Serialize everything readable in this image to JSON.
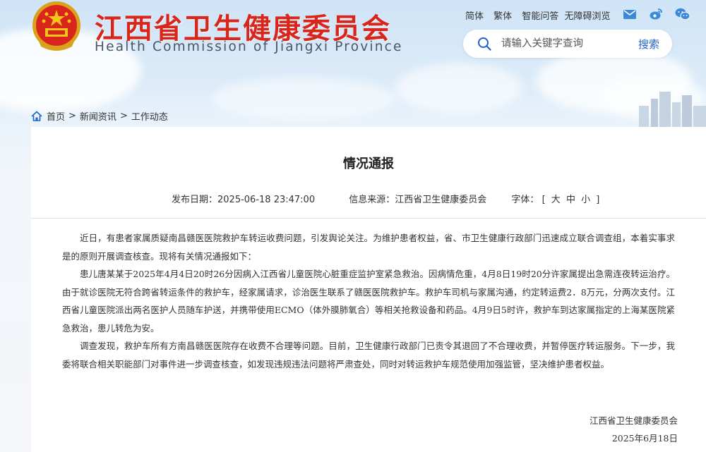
{
  "header": {
    "site_title": "江西省卫生健康委员会",
    "site_subtitle": "Health Commission of Jiangxi Province",
    "links": [
      "简体",
      "繁体",
      "智能问答",
      "无障碍浏览"
    ],
    "social_icons": [
      "mail-icon",
      "weibo-icon",
      "wechat-icon"
    ]
  },
  "search": {
    "placeholder": "请输入关键字查询",
    "button_label": "搜索"
  },
  "breadcrumb": {
    "home": "首页",
    "sep": ">",
    "level2": "新闻资讯",
    "level3": "工作动态"
  },
  "article": {
    "title": "情况通报",
    "publish_label": "发布日期：",
    "publish_date": "2025-06-18 23:47:00",
    "source_label": "信息来源：",
    "source": "江西省卫生健康委员会",
    "font_label": "字体：",
    "font_open": "[",
    "font_large": "大",
    "font_medium": "中",
    "font_small": "小",
    "font_close": "]",
    "paragraphs": [
      "近日，有患者家属质疑南昌赣医医院救护车转运收费问题，引发舆论关注。为维护患者权益，省、市卫生健康行政部门迅速成立联合调查组，本着实事求是的原则开展调查核查。现将有关情况通报如下：",
      "患儿唐某某于2025年4月4日20时26分因病入江西省儿童医院心脏重症监护室紧急救治。因病情危重，4月8日19时20分许家属提出急需连夜转运治疗。由于就诊医院无符合跨省转运条件的救护车，经家属请求，诊治医生联系了赣医医院救护车。救护车司机与家属沟通，约定转运费2．8万元，分两次支付。江西省儿童医院派出两名医护人员随车护送，并携带使用ECMO（体外膜肺氧合）等相关抢救设备和药品。4月9日5时许，救护车到达家属指定的上海某医院紧急救治，患儿转危为安。",
      "调查发现，救护车所有方南昌赣医医院存在收费不合理等问题。目前，卫生健康行政部门已责令其退回了不合理收费，并暂停医疗转运服务。下一步，我委将联合相关职能部门对事件进一步调查核查，如发现违规违法问题将严肃查处，同时对转运救护车规范使用加强监管，坚决维护患者权益。"
    ],
    "signature_org": "江西省卫生健康委员会",
    "signature_date": "2025年6月18日"
  },
  "colors": {
    "title_red": "#d9261c",
    "search_blue": "#1f62c8"
  }
}
